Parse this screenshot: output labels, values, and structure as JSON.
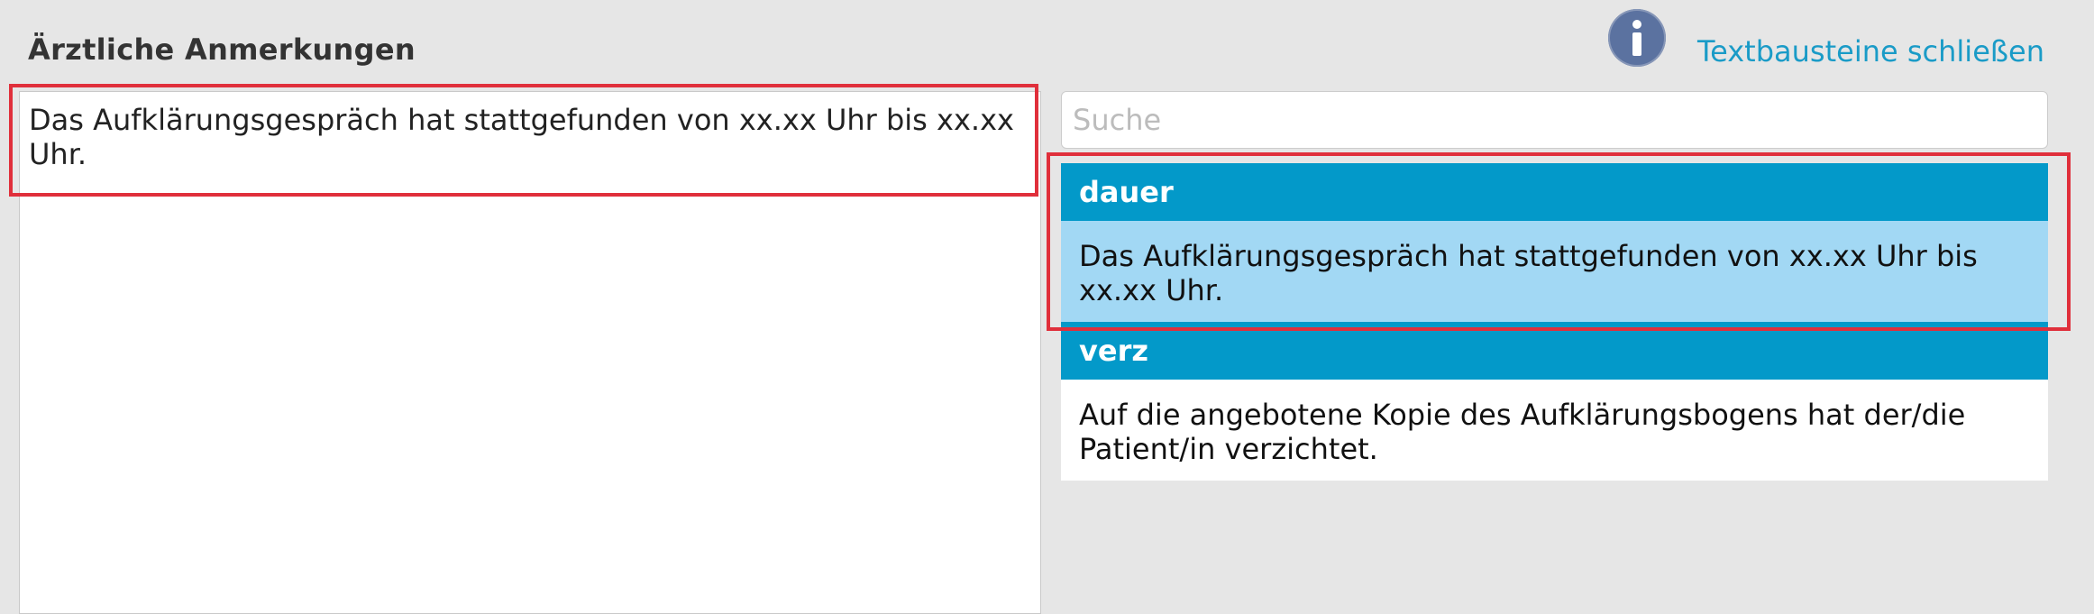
{
  "header": {
    "section_title": "Ärztliche Anmerkungen",
    "info_icon": "info-icon",
    "close_link_label": "Textbausteine schließen"
  },
  "notes": {
    "text": "Das Aufklärungsgespräch hat stattgefunden von xx.xx Uhr bis xx.xx Uhr."
  },
  "search": {
    "value": "",
    "placeholder": "Suche"
  },
  "snippets": [
    {
      "key": "dauer",
      "text": "Das Aufklärungsgespräch hat stattgefunden von xx.xx Uhr bis xx.xx Uhr.",
      "selected": true
    },
    {
      "key": "verz",
      "text": "Auf die angebotene Kopie des Aufklärungsbogens hat der/die Patient/in verzichtet.",
      "selected": false
    }
  ],
  "colors": {
    "header_blue": "#0399c9",
    "selected_bg": "#a2d8f4",
    "link": "#1a9bc7",
    "highlight_red": "#e02f3b",
    "page_bg": "#e6e6e6"
  }
}
